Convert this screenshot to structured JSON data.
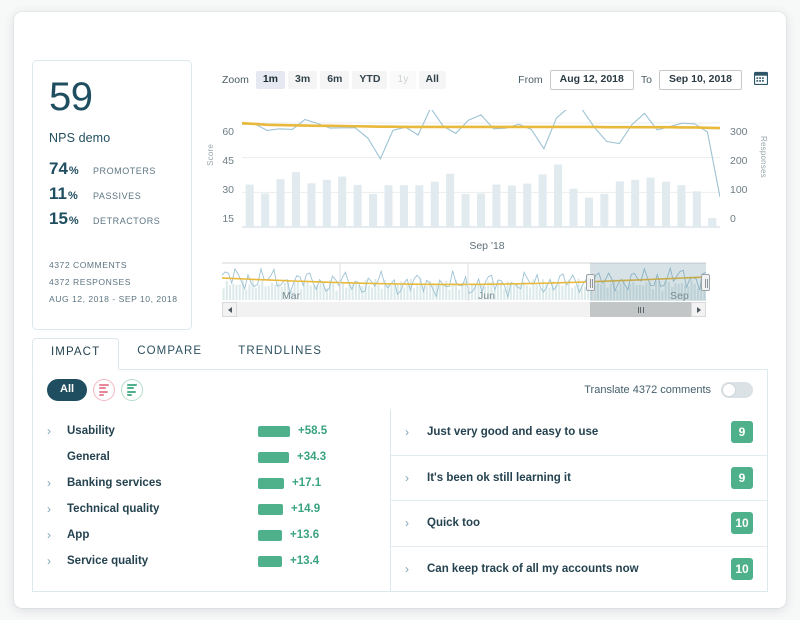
{
  "nps": {
    "score": "59",
    "name": "NPS demo",
    "breakdown": [
      {
        "value": "74",
        "symbol": "%",
        "label": "PROMOTERS"
      },
      {
        "value": "11",
        "symbol": "%",
        "label": "PASSIVES"
      },
      {
        "value": "15",
        "symbol": "%",
        "label": "DETRACTORS"
      }
    ],
    "meta": [
      "4372 COMMENTS",
      "4372 RESPONSES",
      "AUG 12, 2018 - SEP 10, 2018"
    ]
  },
  "toolbar": {
    "zoom_label": "Zoom",
    "zoom_buttons": [
      {
        "label": "1m",
        "state": "active"
      },
      {
        "label": "3m",
        "state": "normal"
      },
      {
        "label": "6m",
        "state": "normal"
      },
      {
        "label": "YTD",
        "state": "normal"
      },
      {
        "label": "1y",
        "state": "disabled"
      },
      {
        "label": "All",
        "state": "normal"
      }
    ],
    "from_label": "From",
    "from_value": "Aug 12, 2018",
    "to_label": "To",
    "to_value": "Sep 10, 2018",
    "calendar_icon": "calendar-icon"
  },
  "chart_data": {
    "type": "line",
    "title": "",
    "xlabel": "Sep '18",
    "ylabel": "Score",
    "y2label": "Responses",
    "ylim": [
      15,
      60
    ],
    "y2lim": [
      0,
      300
    ],
    "yticks": [
      "60",
      "45",
      "30",
      "15"
    ],
    "y2ticks": [
      "300",
      "200",
      "100",
      "0"
    ],
    "grid": true,
    "legend": "none",
    "series": [
      {
        "name": "Score",
        "type": "line",
        "color": "#9dc3d4",
        "values": [
          59.5,
          59.6,
          56.8,
          57.5,
          57.2,
          61.5,
          59.8,
          57.8,
          57.9,
          57.9,
          53.5,
          44.5,
          56.8,
          58.2,
          54.8,
          66.5,
          58.6,
          55.5,
          61.2,
          63.5,
          57.5,
          57.8,
          59.5,
          57.2,
          48.9,
          62.2,
          66.8,
          66.2,
          58.2,
          52.0,
          51.1,
          59.3,
          64.2,
          57.0,
          58.4,
          59.9,
          59.6,
          56.1,
          28.0
        ]
      },
      {
        "name": "Trend",
        "type": "line",
        "color": "#e8b93a",
        "values": [
          59.9,
          59.6,
          59.2,
          59.1,
          59.0,
          58.9,
          58.8,
          58.8,
          58.7,
          58.6,
          58.5,
          58.4,
          58.4,
          58.3,
          58.3,
          58.3,
          58.3,
          58.3,
          58.3,
          58.3,
          58.3,
          58.3,
          58.3,
          58.3,
          58.3,
          58.3,
          58.3,
          58.3,
          58.3,
          58.2,
          58.2,
          58.2,
          58.2,
          58.2,
          58.2,
          58.1,
          58.1,
          57.9,
          57.8
        ]
      },
      {
        "name": "Responses",
        "type": "bar",
        "color": "#e0eaef",
        "values": [
          133,
          105,
          150,
          172,
          137,
          148,
          158,
          132,
          104,
          131,
          131,
          131,
          142,
          167,
          104,
          105,
          133,
          130,
          136,
          165,
          196,
          120,
          92,
          104,
          143,
          148,
          155,
          142,
          131,
          112,
          28
        ]
      }
    ]
  },
  "navigator": {
    "months": [
      "Mar",
      "Jun",
      "Sep"
    ],
    "left_arrow": "scroll-left-arrow",
    "right_arrow": "scroll-right-arrow"
  },
  "tabs": [
    {
      "label": "IMPACT",
      "active": true
    },
    {
      "label": "COMPARE",
      "active": false
    },
    {
      "label": "TRENDLINES",
      "active": false
    }
  ],
  "filters": {
    "all_label": "All",
    "negative_icon": "negative-bars-icon",
    "positive_icon": "positive-bars-icon",
    "translate_label": "Translate 4372 comments",
    "translate_on": false
  },
  "topics": [
    {
      "name": "Usability",
      "value": "+58.5",
      "bar_pct": 100,
      "expandable": true,
      "indent": false
    },
    {
      "name": "General",
      "value": "+34.3",
      "bar_pct": 97,
      "expandable": false,
      "indent": true
    },
    {
      "name": "Banking services",
      "value": "+17.1",
      "bar_pct": 80,
      "expandable": true,
      "indent": false
    },
    {
      "name": "Technical quality",
      "value": "+14.9",
      "bar_pct": 78,
      "expandable": true,
      "indent": false
    },
    {
      "name": "App",
      "value": "+13.6",
      "bar_pct": 76,
      "expandable": true,
      "indent": false
    },
    {
      "name": "Service quality",
      "value": "+13.4",
      "bar_pct": 76,
      "expandable": true,
      "indent": false
    }
  ],
  "comments": [
    {
      "text": "Just very good and easy to use",
      "score": "9"
    },
    {
      "text": "It's been ok still learning it",
      "score": "9"
    },
    {
      "text": "Quick too",
      "score": "10"
    },
    {
      "text": "Can keep track of all my accounts now",
      "score": "10"
    }
  ],
  "colors": {
    "brand_dark": "#1f4e60",
    "accent_green": "#4fb08c",
    "trend_yellow": "#e8b93a",
    "score_line": "#9dc3d4",
    "bar_fill": "#e0eaef",
    "negative": "#e8879a"
  }
}
